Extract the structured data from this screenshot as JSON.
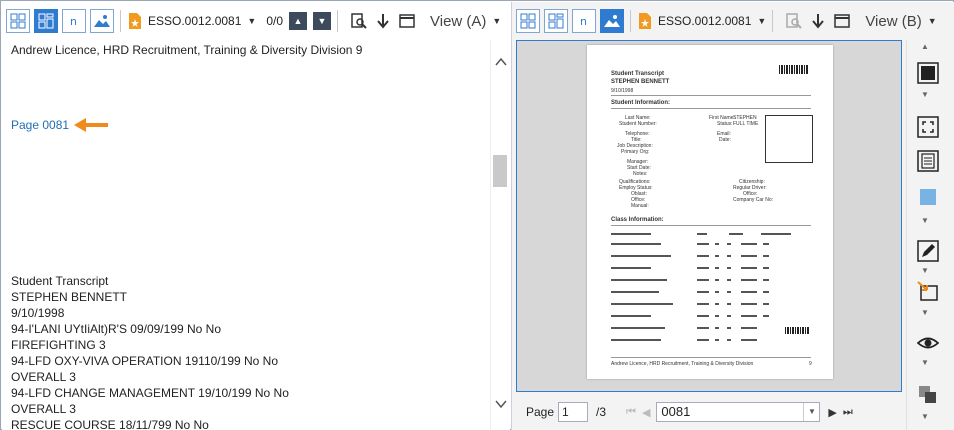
{
  "pane_a": {
    "toolbar": {
      "doc_name": "ESSO.0012.0081",
      "match_count": "0/0",
      "view_label": "View (A)"
    },
    "text_lines": [
      "Andrew Licence, HRD Recruitment, Training & Diversity Division 9",
      "Page 0081",
      "Student Transcript",
      "STEPHEN BENNETT",
      "9/10/1998",
      "94-I'LANI UYtIiAlt)R'S 09/09/199 No No",
      "FIREFIGHTING 3",
      "94-LFD OXY-VIVA OPERATION 19110/199 No No",
      "OVERALL 3",
      "94-LFD CHANGE MANAGEMENT 19/10/199 No No",
      "OVERALL 3",
      "RESCUE COURSE 18/11/799 No No"
    ]
  },
  "pane_b": {
    "toolbar": {
      "doc_name": "ESSO.0012.0081",
      "view_label": "View (B)"
    },
    "document_page": {
      "title": "Student Transcript",
      "name": "STEPHEN BENNETT",
      "date": "9/10/1998",
      "section_student": "Student Information:",
      "section_class": "Class Information:",
      "fields_left": [
        "Last Name:",
        "Student Number:",
        "Telephone:",
        "Title:",
        "Job Description:",
        "Primary Org:",
        "Manager:",
        "Start Date:",
        "Notes:"
      ],
      "fields_right": [
        "First Name:",
        "Status:",
        "Email:",
        "Date:"
      ],
      "values_right": [
        "STEPHEN",
        "FULL TIME"
      ],
      "qual_labels": [
        "Qualifications:",
        "Employ Status:",
        "Oblast:",
        "Office:",
        "Manual:"
      ],
      "qual_right": [
        "Citizenship:",
        "Regular Driver:",
        "Office:",
        "Company Car No:"
      ],
      "footer": "Andrew Licence, HRD Recruitment, Training & Diversity Division",
      "page_no": "9"
    },
    "status": {
      "page_label": "Page",
      "page_value": "1",
      "page_total": "/3",
      "page_name": "0081"
    }
  },
  "colors": {
    "accent": "#2f7bd0",
    "link": "#1f6fb3",
    "arrow": "#f08a1c",
    "toolbar_dark": "#3d4a5c"
  }
}
